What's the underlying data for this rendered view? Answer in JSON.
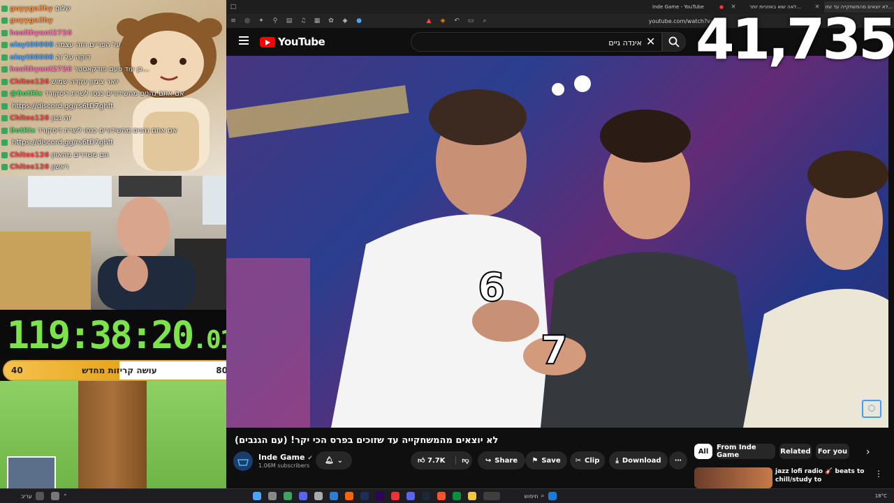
{
  "chat": {
    "lines": [
      {
        "user": "guyyga3hy",
        "msg": "שלום",
        "color": "#ff8c3a"
      },
      {
        "user": "guyyga3hy",
        "msg": "",
        "color": "#ff8c3a"
      },
      {
        "user": "healthyant2726",
        "msg": "",
        "color": "#ff69b4"
      },
      {
        "user": "elayt00008",
        "msg": "על הפריים הזה עצמה",
        "color": "#4aa3ff"
      },
      {
        "user": "elayt00008",
        "msg": "דוקה על זה",
        "color": "#4aa3ff"
      },
      {
        "user": "healthyant2726",
        "msg": "כן עוד פעם פודקאסטר...",
        "color": "#ff69b4"
      },
      {
        "user": "Chitos126",
        "msg": "יואר צימון עקדה שמוש",
        "color": "#ff4a4a"
      },
      {
        "user": "@BotRix",
        "msg": "אם אתם נהנים מהשידורים כנסו לשרת דיסקורד",
        "color": "#4ad36a"
      },
      {
        "user": "",
        "msg": "https://discord.gg/rs6tD7ghft",
        "color": "#ffffff"
      },
      {
        "user": "Chitos126",
        "msg": "זה נכון",
        "color": "#ff4a4a"
      },
      {
        "user": "BotRix",
        "msg": "אם אתם נהנים מהשידורים כנסו לשרת דיסקורד",
        "color": "#4ad36a"
      },
      {
        "user": "",
        "msg": "https://discord.gg/rs6tD7ghft",
        "color": "#ffffff"
      },
      {
        "user": "Chitos126",
        "msg": "הם משדרים מהאוזן",
        "color": "#ff4a4a"
      },
      {
        "user": "Chitos126",
        "msg": "ראשון",
        "color": "#ff4a4a"
      }
    ]
  },
  "timer": {
    "main": "119:38:20",
    "fraction": ".01"
  },
  "progress": {
    "left_value": "40",
    "right_value": "80",
    "label": "עושה קריזות מחדש",
    "level": 0.5
  },
  "browser": {
    "tabs": [
      "Inde Game - YouTube",
      "לאה שוא באוזניות יותר...",
      "לא יוצאים מהמשחקייה עד שזו..."
    ],
    "url": "youtube.com/watch?v=uD2"
  },
  "youtube": {
    "logo_text": "YouTube",
    "search_value": "אינדה גיים",
    "view_count": "41,735",
    "video": {
      "title": "לא יוצאים מהמשחקייה עד שזוכים בפרס הכי יקר! (עם הגנבים)",
      "overlay_numbers": [
        "6",
        "7"
      ]
    },
    "channel": {
      "name": "Inde Game",
      "subscribers": "1.06M subscribers"
    },
    "actions": {
      "like_count": "7.7K",
      "share": "Share",
      "save": "Save",
      "clip": "Clip",
      "download": "Download"
    },
    "chips": [
      "All",
      "From Inde Game",
      "Related",
      "For you"
    ],
    "up_next": {
      "title": "jazz lofi radio 🎸 beats to chill/study to"
    }
  },
  "taskbar": {
    "search_label": "חיפוש",
    "clock": "18°C",
    "weather": "עריב"
  }
}
